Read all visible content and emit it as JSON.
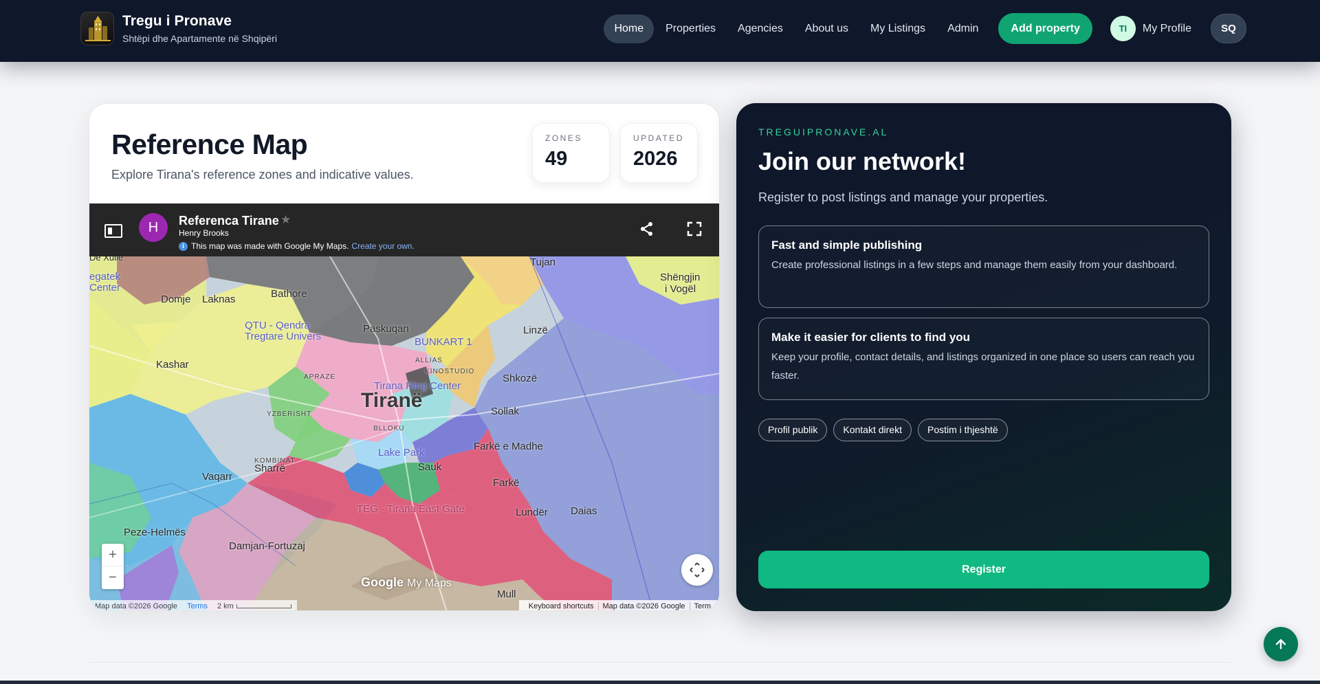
{
  "brand": {
    "title": "Tregu i Pronave",
    "subtitle": "Shtëpi dhe Apartamente në Shqipëri"
  },
  "nav": {
    "links": [
      "Home",
      "Properties",
      "Agencies",
      "About us",
      "My Listings",
      "Admin"
    ],
    "active": "Home",
    "add_property": "Add property",
    "profile_initials": "TI",
    "profile_label": "My Profile",
    "language": "SQ"
  },
  "map_card": {
    "title": "Reference Map",
    "subtitle": "Explore Tirana's reference zones and indicative values.",
    "stats": [
      {
        "label": "ZONES",
        "value": "49"
      },
      {
        "label": "UPDATED",
        "value": "2026"
      }
    ],
    "embed": {
      "map_title": "Referenca Tirane",
      "author": "Henry Brooks",
      "author_initial": "H",
      "notice": "This map was made with Google My Maps.",
      "notice_link": "Create your own.",
      "watermark_brand": "Google",
      "watermark_product": "My Maps",
      "attribution_left": "Map data ©2026 Google",
      "terms_left": "Terms",
      "scale": "2 km",
      "attribution_right": [
        "Keyboard shortcuts",
        "Map data ©2026 Google",
        "Term"
      ],
      "zoom_in": "+",
      "zoom_out": "−",
      "labels": {
        "tirane": "Tiranë",
        "tujan": "Tujan",
        "shengjin": "Shëngjin",
        "shengjin2": "i Vogël",
        "laknas": "Laknas",
        "domje": "Domje",
        "bathore": "Bathore",
        "paskuqan": "Paskuqan",
        "linze": "Linzë",
        "kashar": "Kashar",
        "shkoze": "Shkozë",
        "yzberisht": "YZBERISHT",
        "kombinat": "KOMBINAT",
        "sollak": "Sollak",
        "farke_madhe": "Farkë e Madhe",
        "farke": "Farkë",
        "sauk": "Sauk",
        "sharre": "Sharrë",
        "vaqarr": "Vaqarr",
        "lunder": "Lundër",
        "daias": "Daias",
        "peze": "Peze-Helmës",
        "damjan": "Damjan-Fortuzaj",
        "mull": "Mull",
        "qtu": "QTU - Qendra",
        "qtu2": "Tregtare Univers",
        "bunkart": "BUNKART 1",
        "teg": "TEG - Tirana East Gate",
        "ring": "Tirana Ring Center",
        "lake": "Lake Park",
        "blloku": "BLLOKU",
        "allias": "ALLIAS",
        "kinostudio": "KINOSTUDIO",
        "apraze": "APRAZE",
        "dexulle": "De Xulle",
        "egatek": "egatek",
        "center": "Center"
      }
    }
  },
  "join_card": {
    "eyebrow": "TREGUIPRONAVE.AL",
    "title": "Join our network!",
    "subtitle": "Register to post listings and manage your properties.",
    "features": [
      {
        "title": "Fast and simple publishing",
        "text": "Create professional listings in a few steps and manage them easily from your dashboard."
      },
      {
        "title": "Make it easier for clients to find you",
        "text": "Keep your profile, contact details, and listings organized in one place so users can reach you faster."
      }
    ],
    "chips": [
      "Profil publik",
      "Kontakt direkt",
      "Postim i thjeshtë"
    ],
    "register": "Register"
  },
  "colors": {
    "nav_bg": "#0f172a",
    "accent_green": "#10b981",
    "add_btn": "#10a472",
    "totop": "#047857"
  },
  "icons": {
    "share": "share-icon",
    "fullscreen": "fullscreen-icon",
    "sidebar": "sidebar-toggle-icon",
    "recenter": "recenter-icon",
    "totop": "arrow-up-icon"
  }
}
